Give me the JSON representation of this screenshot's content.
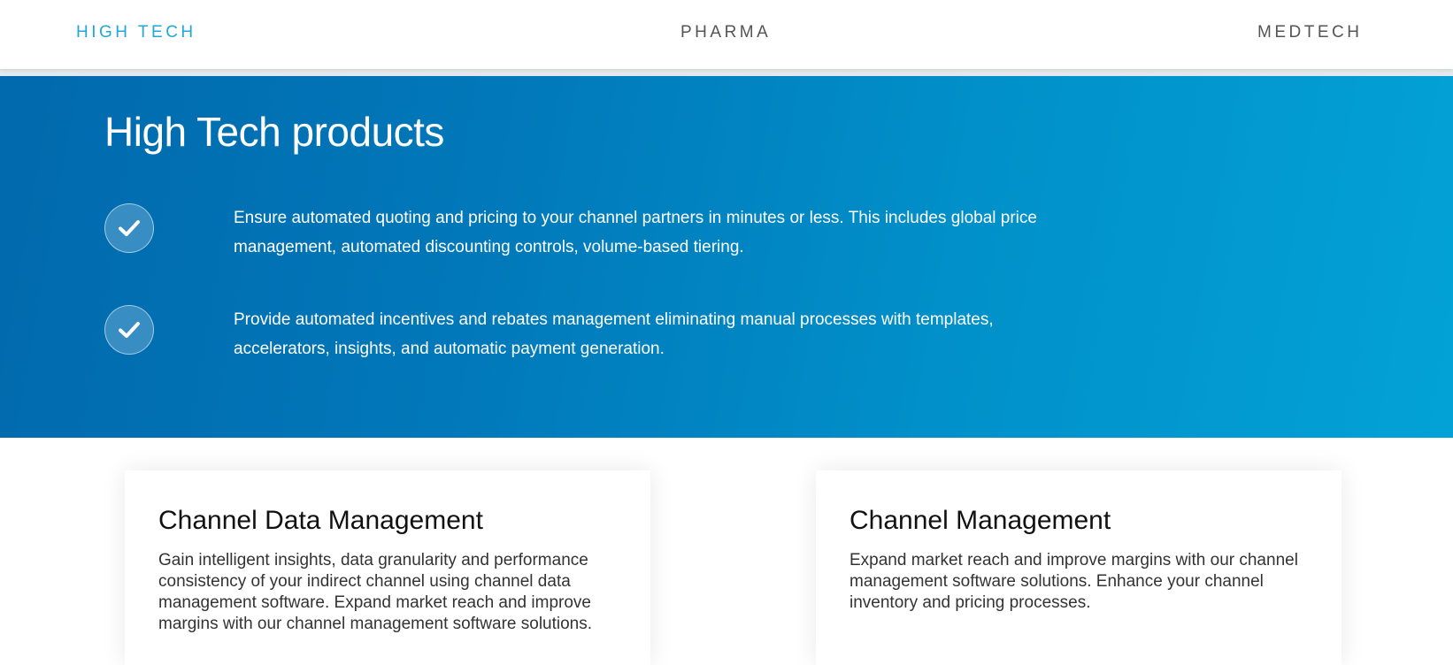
{
  "tabs": [
    {
      "label": "HIGH TECH",
      "active": true
    },
    {
      "label": "PHARMA",
      "active": false
    },
    {
      "label": "MEDTECH",
      "active": false
    }
  ],
  "hero": {
    "title": "High Tech products",
    "features": [
      {
        "icon": "checkmark-icon",
        "text": "Ensure automated quoting and pricing to your channel partners in minutes or less. This includes global price management, automated discounting controls, volume-based tiering."
      },
      {
        "icon": "checkmark-icon",
        "text": "Provide automated incentives and rebates management eliminating manual processes with templates, accelerators, insights, and automatic payment generation."
      }
    ]
  },
  "cards": [
    {
      "title": "Channel Data Management",
      "body": "Gain intelligent insights, data granularity and performance consistency of your indirect channel using channel data management software. Expand market reach and improve margins with our channel management software solutions."
    },
    {
      "title": "Channel Management",
      "body": "Expand market reach and improve margins with our channel management software solutions. Enhance your channel inventory and pricing processes."
    }
  ],
  "colors": {
    "active_tab": "#1fa8d8",
    "inactive_tab": "#555555",
    "hero_gradient_start": "#0169ad",
    "hero_gradient_end": "#02a2d6"
  }
}
